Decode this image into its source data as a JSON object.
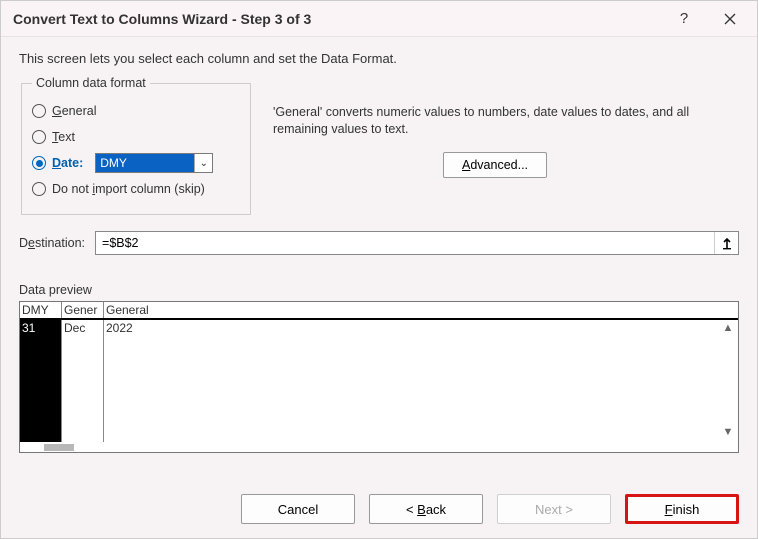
{
  "title": "Convert Text to Columns Wizard - Step 3 of 3",
  "description": "This screen lets you select each column and set the Data Format.",
  "format_group": {
    "legend": "Column data format",
    "general": "General",
    "text": "Text",
    "date": "Date:",
    "date_value": "DMY",
    "skip": "Do not import column (skip)"
  },
  "help_text": "'General' converts numeric values to numbers, date values to dates, and all remaining values to text.",
  "advanced_label": "Advanced...",
  "destination_label": "Destination:",
  "destination_value": "=$B$2",
  "preview_label": "Data preview",
  "preview": {
    "headers": [
      "DMY",
      "Gener",
      "General"
    ],
    "row": [
      "31",
      "Dec",
      "2022"
    ]
  },
  "buttons": {
    "cancel": "Cancel",
    "back": "< Back",
    "next": "Next >",
    "finish": "Finish"
  }
}
